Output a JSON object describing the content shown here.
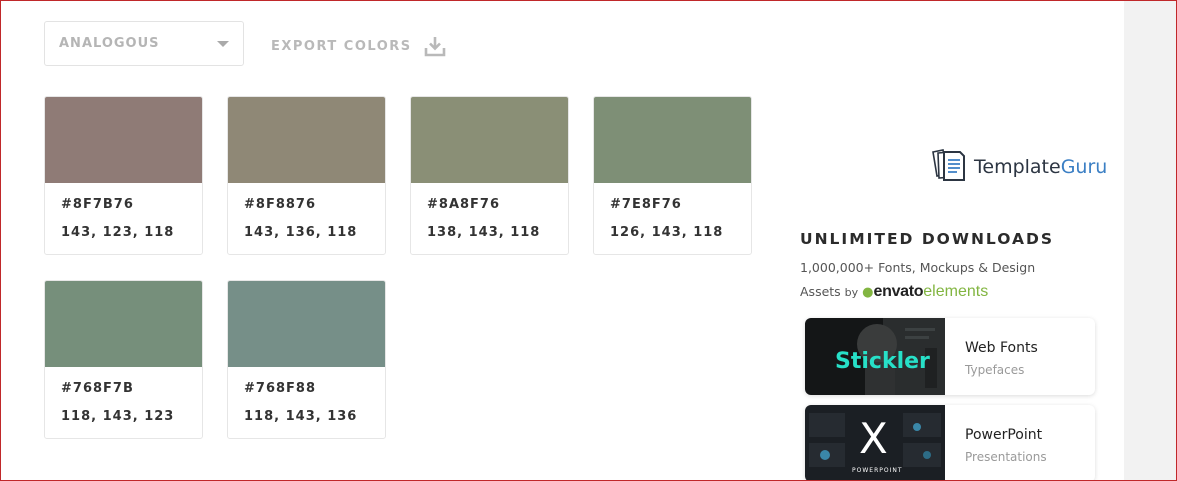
{
  "toolbar": {
    "scheme_select": "ANALOGOUS",
    "export_label": "EXPORT COLORS"
  },
  "swatches": [
    {
      "hex": "#8F7B76",
      "rgb": "143, 123, 118",
      "color": "#8F7B76"
    },
    {
      "hex": "#8F8876",
      "rgb": "143, 136, 118",
      "color": "#8F8876"
    },
    {
      "hex": "#8A8F76",
      "rgb": "138, 143, 118",
      "color": "#8A8F76"
    },
    {
      "hex": "#7E8F76",
      "rgb": "126, 143, 118",
      "color": "#7E8F76"
    },
    {
      "hex": "#768F7B",
      "rgb": "118, 143, 123",
      "color": "#768F7B"
    },
    {
      "hex": "#768F88",
      "rgb": "118, 143, 136",
      "color": "#768F88"
    }
  ],
  "sidebar": {
    "logo_part1": "Template",
    "logo_part2": "Guru",
    "ad_title": "UNLIMITED DOWNLOADS",
    "ad_subtitle": "1,000,000+ Fonts, Mockups & Design",
    "ad_assets": "Assets",
    "ad_by": "by",
    "envato": "envato",
    "elements": "elements",
    "cards": [
      {
        "title": "Web Fonts",
        "subtitle": "Typefaces",
        "thumb_text": "Stickler"
      },
      {
        "title": "PowerPoint",
        "subtitle": "Presentations",
        "thumb_text": "X",
        "thumb_caption": "POWERPOINT"
      }
    ]
  },
  "colors": {
    "frame": "#c0282a",
    "envato_green": "#82b541",
    "logo_blue": "#3b7fc4",
    "stickler_teal": "#27e0c8"
  }
}
